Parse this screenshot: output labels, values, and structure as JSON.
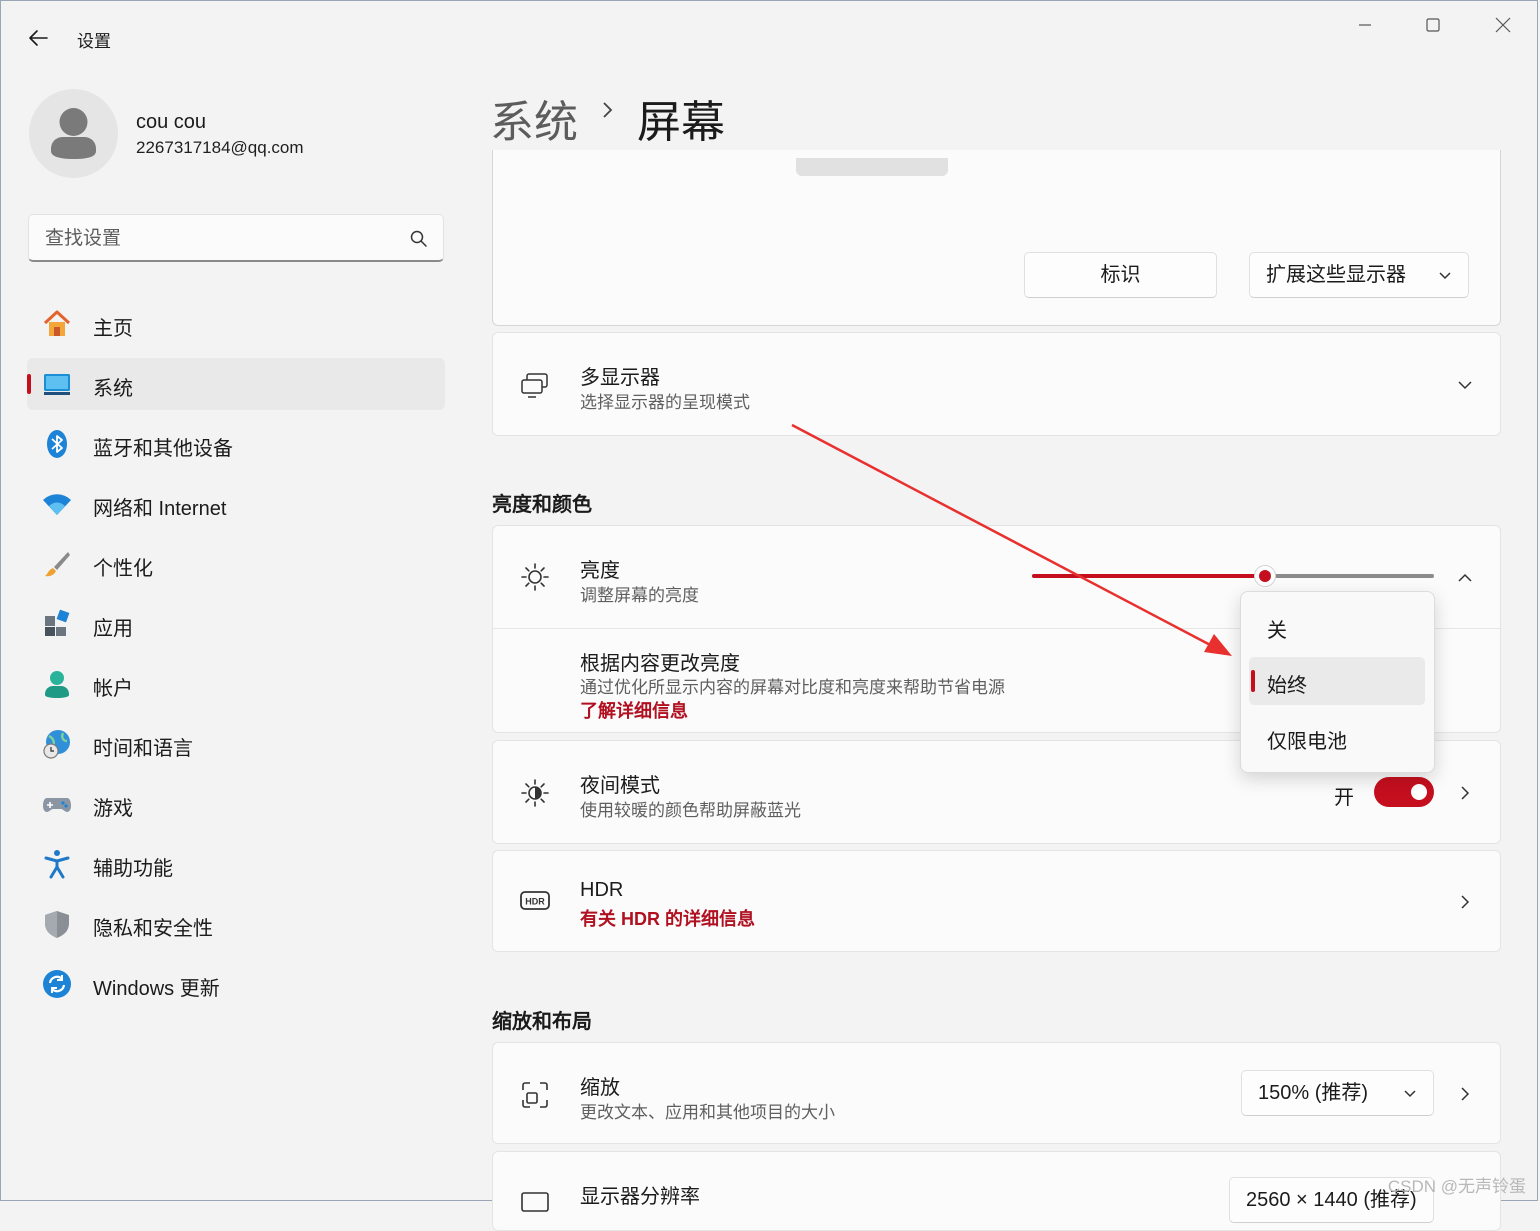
{
  "window": {
    "title": "设置"
  },
  "user": {
    "name": "cou cou",
    "email": "2267317184@qq.com"
  },
  "search": {
    "placeholder": "查找设置"
  },
  "nav": [
    {
      "label": "主页",
      "icon": "home-icon"
    },
    {
      "label": "系统",
      "icon": "system-display-icon",
      "active": true
    },
    {
      "label": "蓝牙和其他设备",
      "icon": "bluetooth-icon"
    },
    {
      "label": "网络和 Internet",
      "icon": "wifi-icon"
    },
    {
      "label": "个性化",
      "icon": "paintbrush-icon"
    },
    {
      "label": "应用",
      "icon": "apps-icon"
    },
    {
      "label": "帐户",
      "icon": "account-icon"
    },
    {
      "label": "时间和语言",
      "icon": "globe-clock-icon"
    },
    {
      "label": "游戏",
      "icon": "gamepad-icon"
    },
    {
      "label": "辅助功能",
      "icon": "accessibility-icon"
    },
    {
      "label": "隐私和安全性",
      "icon": "shield-icon"
    },
    {
      "label": "Windows 更新",
      "icon": "update-icon"
    }
  ],
  "breadcrumb": {
    "parent": "系统",
    "current": "屏幕"
  },
  "arrangement": {
    "identify_label": "标识",
    "mode_value": "扩展这些显示器"
  },
  "multi_display": {
    "title": "多显示器",
    "subtitle": "选择显示器的呈现模式"
  },
  "section_brightness": "亮度和颜色",
  "brightness": {
    "title": "亮度",
    "subtitle": "调整屏幕的亮度",
    "level_fraction": 0.58
  },
  "content_brightness": {
    "title": "根据内容更改亮度",
    "subtitle": "通过优化所显示内容的屏幕对比度和亮度来帮助节省电源",
    "link": "了解详细信息"
  },
  "flyout": {
    "options": [
      "关",
      "始终",
      "仅限电池"
    ],
    "selected_index": 1
  },
  "night_light": {
    "title": "夜间模式",
    "subtitle": "使用较暖的颜色帮助屏蔽蓝光",
    "state_label": "开",
    "on": true
  },
  "hdr": {
    "title": "HDR",
    "link": "有关 HDR 的详细信息"
  },
  "section_scale": "缩放和布局",
  "scale": {
    "title": "缩放",
    "subtitle": "更改文本、应用和其他项目的大小",
    "value": "150% (推荐)"
  },
  "resolution": {
    "title": "显示器分辨率",
    "value": "2560 × 1440 (推荐)"
  },
  "watermark": "CSDN @无声铃蛋",
  "colors": {
    "accent": "#c50f1f",
    "annotation": "#e8302f"
  }
}
